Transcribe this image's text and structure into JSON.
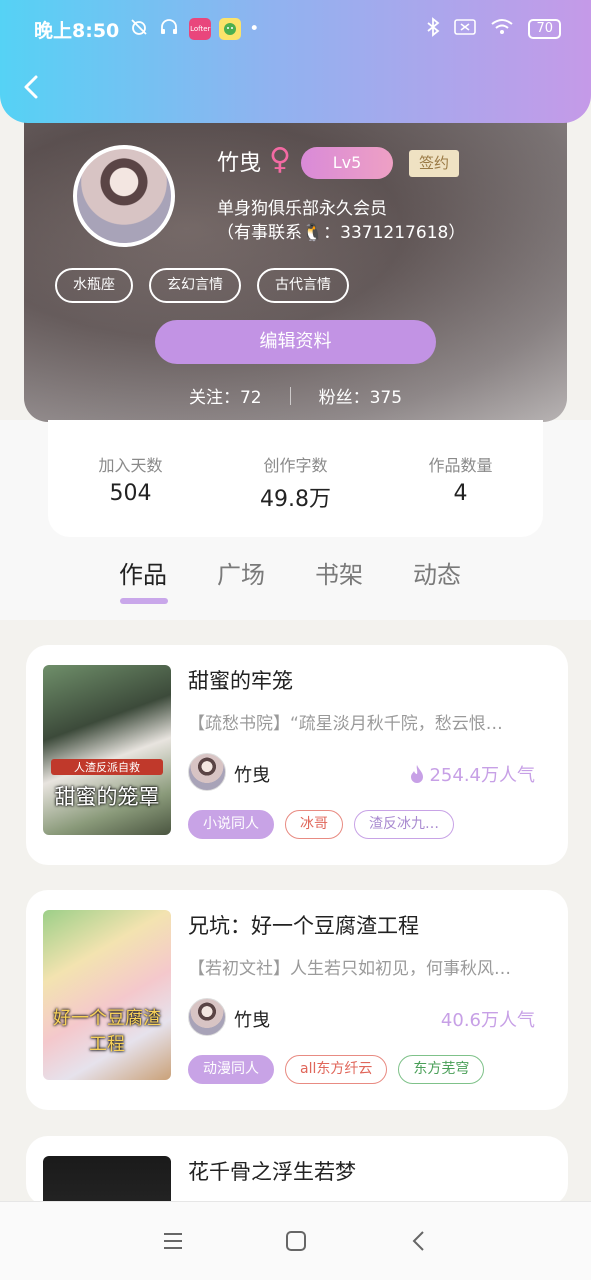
{
  "status_bar": {
    "time": "晚上8:50",
    "battery": "70",
    "app_badge": "Lofter"
  },
  "profile": {
    "name": "竹曳",
    "gender_symbol": "♀",
    "level": "Lv5",
    "signed_badge": "签约",
    "bio_line1": "单身狗俱乐部永久会员",
    "bio_line2": "（有事联系🐧：3371217618）",
    "tags": [
      "水瓶座",
      "玄幻言情",
      "古代言情"
    ],
    "edit_button": "编辑资料",
    "following": "关注：72",
    "followers": "粉丝：375"
  },
  "stats": [
    {
      "label": "加入天数",
      "value": "504"
    },
    {
      "label": "创作字数",
      "value": "49.8万"
    },
    {
      "label": "作品数量",
      "value": "4"
    }
  ],
  "tabs": [
    "作品",
    "广场",
    "书架",
    "动态"
  ],
  "works": [
    {
      "title": "甜蜜的牢笼",
      "desc": "【疏愁书院】“疏星淡月秋千院，愁云恨…",
      "author": "竹曳",
      "popularity": "254.4万人气",
      "cover_title": "甜蜜的笼罩",
      "cover_sub": "人渣反派自救",
      "tags": [
        "小说同人",
        "冰哥",
        "渣反冰九…"
      ]
    },
    {
      "title": "兄坑：好一个豆腐渣工程",
      "desc": "【若初文社】人生若只如初见，何事秋风…",
      "author": "竹曳",
      "popularity": "40.6万人气",
      "cover_title": "好一个豆腐渣工程",
      "tags": [
        "动漫同人",
        "all东方纤云",
        "东方芜穹"
      ]
    },
    {
      "title": "花千骨之浮生若梦"
    }
  ],
  "colors": {
    "header_gradient_start": "#55d2f5",
    "header_gradient_end": "#c59ae8",
    "accent": "#c8a3e6"
  }
}
